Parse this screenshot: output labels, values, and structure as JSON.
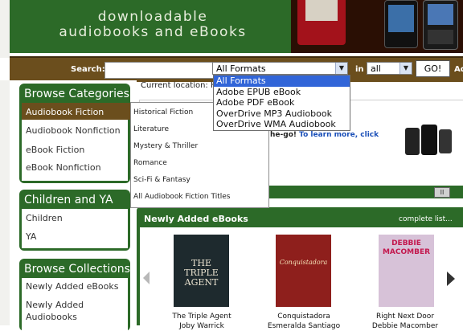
{
  "banner": {
    "title_line1": "downloadable",
    "title_line2": "audiobooks and eBooks"
  },
  "search": {
    "label": "Search:",
    "query": "",
    "format_selected": "All Formats",
    "in_label": "in",
    "lang_selected": "all",
    "go_label": "GO!",
    "trailing_label": "Ad"
  },
  "format_options": [
    {
      "label": "All Formats",
      "selected": true
    },
    {
      "label": "Adobe EPUB eBook"
    },
    {
      "label": "Adobe PDF eBook"
    },
    {
      "label": "OverDrive MP3 Audiobook"
    },
    {
      "label": "OverDrive WMA Audiobook"
    }
  ],
  "sidebar": {
    "browse_categories": {
      "title": "Browse Categories",
      "items": [
        "Audiobook Fiction",
        "Audiobook Nonfiction",
        "eBook Fiction",
        "eBook Nonfiction"
      ]
    },
    "children_ya": {
      "title": "Children and YA",
      "items": [
        "Children",
        "YA"
      ]
    },
    "browse_collections": {
      "title": "Browse Collections",
      "items": [
        "Newly Added eBooks",
        "Newly Added",
        "Audiobooks"
      ]
    }
  },
  "submenu": {
    "items": [
      "Historical Fiction",
      "Literature",
      "Mystery & Thriller",
      "Romance",
      "Sci-Fi & Fantasy",
      "All Audiobook Fiction Titles"
    ]
  },
  "location": {
    "text": "Current location: H"
  },
  "promo": {
    "text": "he-go!",
    "link": "To learn more, click"
  },
  "pause_icon": "pause-icon",
  "new_ebooks": {
    "title": "Newly Added eBooks",
    "complete_list": "complete list...",
    "books": [
      {
        "title": "The Triple Agent",
        "author": "Joby Warrick",
        "cover_color": "#1e2a2e",
        "cover_text": "THE TRIPLE AGENT"
      },
      {
        "title": "Conquistadora",
        "author": "Esmeralda Santiago",
        "cover_color": "#8e1f1c",
        "cover_text": "Conquistadora"
      },
      {
        "title": "Right Next Door",
        "author": "Debbie Macomber",
        "cover_color": "#d7c2d8",
        "cover_text": "DEBBIE MACOMBER"
      }
    ]
  },
  "colors": {
    "green": "#2c6a28",
    "brown": "#6b4e1d",
    "dropdown_highlight": "#3165d8",
    "link_blue": "#1a4fb8"
  }
}
